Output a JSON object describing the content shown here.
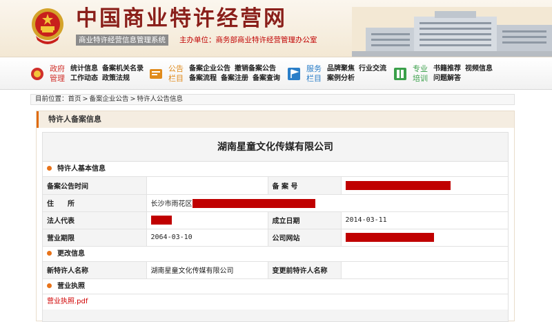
{
  "header": {
    "site_title": "中国商业特许经营网",
    "system_name": "商业特许经营信息管理系统",
    "host": "主办单位：商务部商业特许经营管理办公室"
  },
  "nav": [
    {
      "title_line1": "政府",
      "title_line2": "管理",
      "icon": "emblem-icon",
      "color": "#d0302a",
      "rows": [
        [
          "统计信息",
          "备案机关名录"
        ],
        [
          "工作动态",
          "政策法规"
        ]
      ]
    },
    {
      "title_line1": "公告",
      "title_line2": "栏目",
      "icon": "bulletin-icon",
      "color": "#e08a1a",
      "rows": [
        [
          "备案企业公告",
          "撤销备案公告"
        ],
        [
          "备案流程",
          "备案注册",
          "备案查询"
        ]
      ]
    },
    {
      "title_line1": "服务",
      "title_line2": "栏目",
      "icon": "flag-icon",
      "color": "#2a7ec8",
      "rows": [
        [
          "品牌聚焦",
          "行业交流"
        ],
        [
          "案例分析"
        ]
      ]
    },
    {
      "title_line1": "专业",
      "title_line2": "培训",
      "icon": "book-icon",
      "color": "#3aa04a",
      "rows": [
        [
          "书籍推荐",
          "视频信息"
        ],
        [
          "问题解答"
        ]
      ]
    }
  ],
  "breadcrumb": {
    "prefix": "目前位置：",
    "items": [
      "首页",
      "备案企业公告",
      "特许人公告信息"
    ]
  },
  "panel": {
    "title": "特许人备案信息",
    "company_name": "湖南星童文化传媒有限公司",
    "basic_section": "特许人基本信息",
    "labels": {
      "announce_time": "备案公告时间",
      "record_no": "备 案 号",
      "address": "住　　所",
      "legal_rep": "法人代表",
      "established": "成立日期",
      "term": "营业期限",
      "website": "公司网站",
      "new_name": "新特许人名称",
      "old_name": "变更前特许人名称"
    },
    "values": {
      "announce_time": "",
      "address_prefix": "长沙市雨花区",
      "established": "2014-03-11",
      "term": "2064-03-10",
      "new_name": "湖南星童文化传媒有限公司",
      "old_name": ""
    },
    "change_section": "更改信息",
    "license_section": "营业执照",
    "license_file": "营业执照.pdf"
  },
  "colors": {
    "accent": "#e06a0a",
    "brand": "#8a1f1a",
    "redaction": "#c00000"
  }
}
